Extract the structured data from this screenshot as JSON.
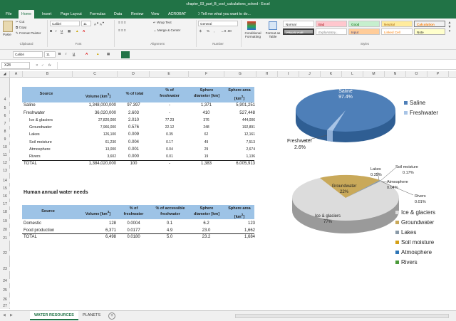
{
  "window_title": "chapter_03_part_B_cool_calculations_solved - Excel",
  "ribbon_tabs": [
    "File",
    "Home",
    "Insert",
    "Page Layout",
    "Formulas",
    "Data",
    "Review",
    "View",
    "ACROBAT"
  ],
  "tell_me": "Tell me what you want to do...",
  "clipboard": {
    "paste": "Paste",
    "cut": "Cut",
    "copy": "Copy",
    "format_painter": "Format Painter",
    "group": "Clipboard"
  },
  "font": {
    "name": "Calibri",
    "size": "11",
    "group": "Font"
  },
  "alignment": {
    "wrap": "Wrap Text",
    "merge": "Merge & Center",
    "group": "Alignment"
  },
  "number": {
    "format": "General",
    "currency": "$",
    "percent": "%",
    "comma": ",",
    "group": "Number"
  },
  "conditional": "Conditional Formatting",
  "format_as_table": "Format as Table",
  "styles": {
    "group": "Styles",
    "items": [
      "Normal",
      "Bad",
      "Good",
      "Neutral",
      "Calculation",
      "Check Cell",
      "Explanatory...",
      "Input",
      "Linked Cell",
      "Note"
    ]
  },
  "format_bar": {
    "font": "Calibri",
    "size": "11"
  },
  "name_box": "X28",
  "fx": "fx",
  "columns": [
    "A",
    "B",
    "C",
    "D",
    "E",
    "F",
    "G",
    "H",
    "I",
    "J",
    "K",
    "L",
    "M",
    "N",
    "O",
    "P"
  ],
  "rows": [
    "4",
    "5",
    "6",
    "7",
    "8",
    "9",
    "10",
    "11",
    "12",
    "13",
    "14",
    "15",
    "16",
    "17",
    "18",
    "19",
    "20",
    "21",
    "22",
    "23",
    "24",
    "25",
    "26",
    "27"
  ],
  "table1": {
    "headers": {
      "source": "Source",
      "volume": "Volume [km",
      "volume_sup": "3",
      "volume_end": "]",
      "pct_total": "% of total",
      "pct_fresh_a": "% of",
      "pct_fresh_b": "freshwater",
      "sphere_a": "Sphere",
      "sphere_b": "diameter [km]",
      "area_a": "Sphere area",
      "area_b": "[km",
      "area_sup": "2",
      "area_end": "]"
    },
    "rows": [
      [
        "Saline",
        "1,348,000,000",
        "97.397",
        "-",
        "1,371",
        "5,901,251"
      ],
      [
        "Freshwater",
        "36,020,000",
        "2.603",
        "-",
        "410",
        "527,448"
      ],
      [
        "Ice & glaciers",
        "27,820,000",
        "2.010",
        "77.23",
        "376",
        "444,006"
      ],
      [
        "Groundwater",
        "7,966,000",
        "0.576",
        "22.12",
        "248",
        "192,891"
      ],
      [
        "Lakes",
        "126,100",
        "0.009",
        "0.35",
        "62",
        "12,161"
      ],
      [
        "Soil moisture",
        "61,230",
        "0.004",
        "0.17",
        "49",
        "7,513"
      ],
      [
        "Atmosphere",
        "13,000",
        "0.001",
        "0.04",
        "29",
        "2,674"
      ],
      [
        "Rivers",
        "3,602",
        "0.000",
        "0.01",
        "19",
        "1,136"
      ],
      [
        "TOTAL",
        "1,384,020,000",
        "100",
        "-",
        "1,383",
        "6,005,913"
      ]
    ]
  },
  "section2_title": "Human annual water needs",
  "table2": {
    "headers": {
      "source": "Source",
      "volume": "Volume [km",
      "volume_sup": "3",
      "volume_end": "]",
      "pct_a": "% of",
      "pct_b": "freshwater",
      "acc_a": "% of accessible",
      "acc_b": "freshwater",
      "sphere_a": "Sphere",
      "sphere_b": "diameter [km]",
      "area_a": "Sphere area",
      "area_b": "[km",
      "area_sup": "2",
      "area_end": "]"
    },
    "rows": [
      [
        "Domestic",
        "128",
        "0.0004",
        "0.1",
        "6.2",
        "123"
      ],
      [
        "Food production",
        "6,371",
        "0.0177",
        "4.9",
        "23.0",
        "1,662"
      ],
      [
        "TOTAL",
        "6,498",
        "0.0180",
        "5.0",
        "23.2",
        "1,684"
      ]
    ]
  },
  "pie1": {
    "labels": [
      {
        "name": "Saline",
        "pct": "97.4%"
      },
      {
        "name": "Freshwater",
        "pct": "2.6%"
      }
    ],
    "legend": [
      "Saline",
      "Freshwater"
    ],
    "colors": [
      "#4e7fb8",
      "#a8c4e6"
    ]
  },
  "pie2": {
    "labels": [
      {
        "name": "Ice & glaciers",
        "pct": "77%"
      },
      {
        "name": "Groundwater",
        "pct": "22%"
      },
      {
        "name": "Lakes",
        "pct": "0.35%"
      },
      {
        "name": "Soil moisture",
        "pct": "0.17%"
      },
      {
        "name": "Atmosphere",
        "pct": "0.04%"
      },
      {
        "name": "Rivers",
        "pct": "0.01%"
      }
    ],
    "legend": [
      "Ice & glaciers",
      "Groundwater",
      "Lakes",
      "Soil moisture",
      "Atmosphere",
      "Rivers"
    ],
    "colors": [
      "#dcdcdc",
      "#c9a95a",
      "#8a9aa8",
      "#d4a017",
      "#2e75b6",
      "#4a9a3a"
    ]
  },
  "sheet_tabs": [
    "WATER RESOURCES",
    "PLANETS"
  ],
  "add_sheet": "+"
}
